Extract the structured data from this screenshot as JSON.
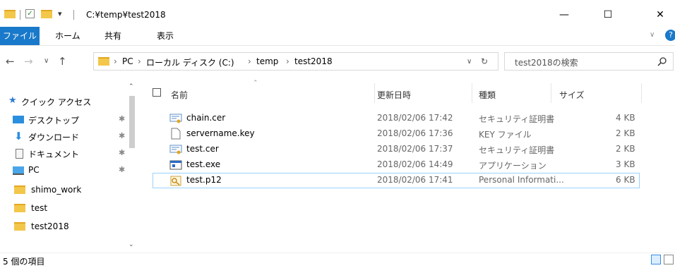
{
  "window": {
    "title": "C:¥temp¥test2018",
    "controls": {
      "minimize": "—",
      "maximize": "☐",
      "close": "✕"
    }
  },
  "ribbon": {
    "tabs": [
      "ファイル",
      "ホーム",
      "共有",
      "表示"
    ],
    "accent": "#1979ca"
  },
  "address": {
    "crumbs": [
      "PC",
      "ローカル ディスク (C:)",
      "temp",
      "test2018"
    ],
    "search_placeholder": "test2018の検索"
  },
  "navigation": {
    "quick_access": "クイック アクセス",
    "items": [
      {
        "label": "デスクトップ",
        "icon": "desktop-icon",
        "pinned": true
      },
      {
        "label": "ダウンロード",
        "icon": "download-icon",
        "pinned": true
      },
      {
        "label": "ドキュメント",
        "icon": "documents-icon",
        "pinned": true
      },
      {
        "label": "PC",
        "icon": "pc-icon",
        "pinned": true
      },
      {
        "label": "shimo_work",
        "icon": "folder-icon",
        "pinned": false
      },
      {
        "label": "test",
        "icon": "folder-icon",
        "pinned": false
      },
      {
        "label": "test2018",
        "icon": "folder-icon",
        "pinned": false
      }
    ]
  },
  "columns": {
    "name": "名前",
    "date": "更新日時",
    "type": "種類",
    "size": "サイズ"
  },
  "files": [
    {
      "name": "chain.cer",
      "date": "2018/02/06 17:42",
      "type": "セキュリティ証明書",
      "size": "4 KB",
      "icon": "certificate-icon"
    },
    {
      "name": "servername.key",
      "date": "2018/02/06 17:36",
      "type": "KEY ファイル",
      "size": "2 KB",
      "icon": "file-icon"
    },
    {
      "name": "test.cer",
      "date": "2018/02/06 17:37",
      "type": "セキュリティ証明書",
      "size": "2 KB",
      "icon": "certificate-icon"
    },
    {
      "name": "test.exe",
      "date": "2018/02/06 14:49",
      "type": "アプリケーション",
      "size": "3 KB",
      "icon": "exe-icon"
    },
    {
      "name": "test.p12",
      "date": "2018/02/06 17:41",
      "type": "Personal Informati...",
      "size": "6 KB",
      "icon": "pfx-icon"
    }
  ],
  "status": {
    "item_count": "5 個の項目"
  }
}
